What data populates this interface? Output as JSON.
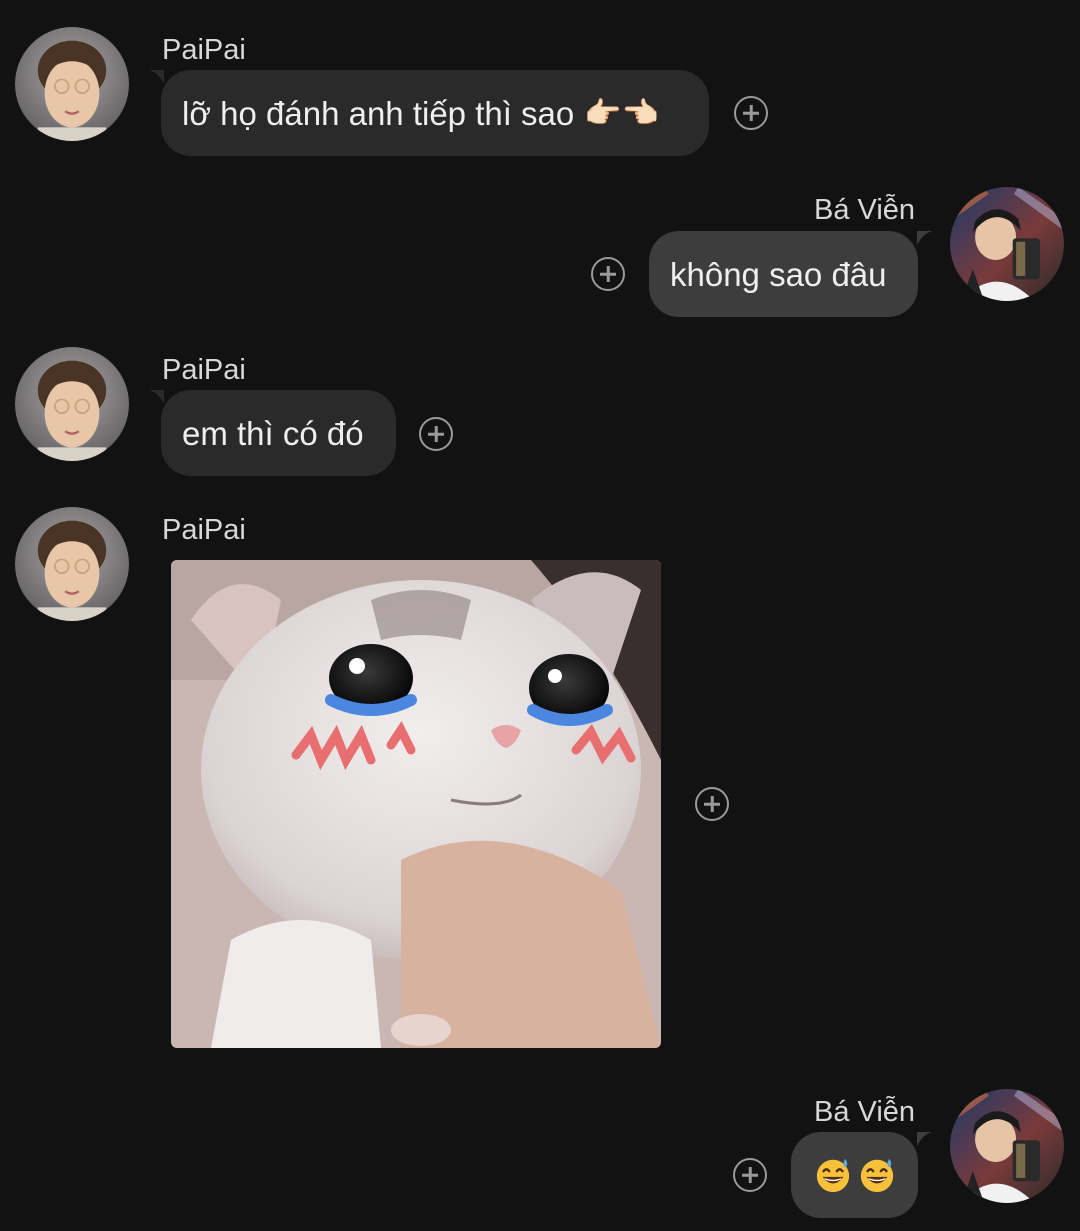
{
  "conversation": {
    "messages": [
      {
        "sender": "PaiPai",
        "text": "lỡ họ đánh anh tiếp thì sao",
        "emoji": "👉🏻👈🏻"
      },
      {
        "sender": "Bá Viễn",
        "text": "không sao đâu"
      },
      {
        "sender": "PaiPai",
        "text": "em thì có đó"
      },
      {
        "sender": "PaiPai",
        "sticker": "crying-cat-sticker"
      },
      {
        "sender": "Bá Viễn",
        "emoji": "😅😅"
      }
    ]
  },
  "icons": {
    "react": "add-reaction-icon",
    "avatar_paipai": "paipai-avatar",
    "avatar_baviem": "ba-vien-avatar"
  },
  "colors": {
    "background": "#121212",
    "incoming_bubble": "#2a2a2a",
    "outgoing_bubble": "#3d3d3d",
    "text": "#efefef"
  }
}
